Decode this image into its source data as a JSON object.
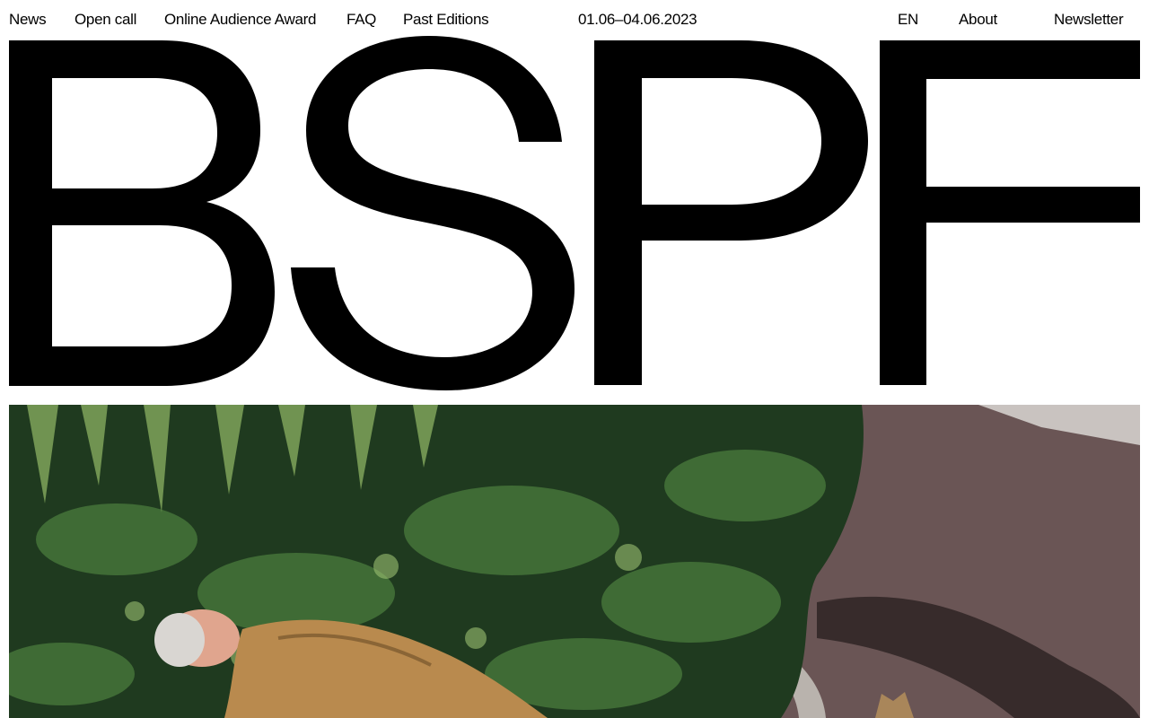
{
  "nav": {
    "news": "News",
    "open_call": "Open call",
    "online_audience_award": "Online Audience Award",
    "faq": "FAQ",
    "past_editions": "Past Editions",
    "dates": "01.06–04.06.2023",
    "language": "EN",
    "about": "About",
    "newsletter": "Newsletter"
  },
  "logo": {
    "text": "BSPF"
  },
  "colors": {
    "background": "#ffffff",
    "text": "#000000",
    "foliage_dark": "#1f3a1f",
    "foliage_mid": "#3f6b35",
    "foliage_light": "#7fa35a",
    "pavement": "#5a4848",
    "coat": "#b98a4e",
    "skin": "#e0a58e"
  },
  "hero_image": {
    "icon": "photo-person-lying-in-bushes"
  }
}
